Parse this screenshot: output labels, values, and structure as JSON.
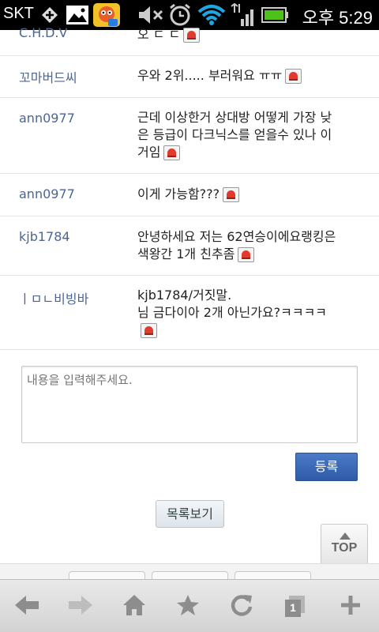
{
  "status_bar": {
    "carrier": "SKT",
    "time": "오후 5:29",
    "icons": [
      "signal-plus-icon",
      "gallery-icon",
      "game-app-icon",
      "mute-icon",
      "alarm-icon",
      "wifi-icon",
      "cell-signal-icon",
      "battery-icon"
    ]
  },
  "comments": [
    {
      "author": "C.H.D.V",
      "text": "오 ㄷ ㄷ"
    },
    {
      "author": "꼬마버드씨",
      "text": "우와 2위..... 부러워요 ㅠㅠ"
    },
    {
      "author": "ann0977",
      "text": "근데 이상한거 상대방 어떻게 가장 낮은 등급이 다크닉스를 얻을수 있나 이거임"
    },
    {
      "author": "ann0977",
      "text": "이게 가능함???"
    },
    {
      "author": "kjb1784",
      "text": "안녕하세요 저는 62연승이에요랭킹은색왕간 1개 친추좀"
    },
    {
      "author": "ㅣㅁㄴ비빙바",
      "text": "kjb1784/거짓말.\n님 금다이아 2개 아닌가요?ㅋㅋㅋㅋ"
    }
  ],
  "form": {
    "placeholder": "내용을 입력해주세요.",
    "submit_label": "등록",
    "list_label": "목록보기",
    "top_label": "TOP"
  },
  "browser_bar": {
    "buttons": [
      "back-icon",
      "forward-icon",
      "home-icon",
      "bookmark-star-icon",
      "refresh-icon",
      "tabs-icon",
      "new-tab-icon"
    ],
    "tab_count": "1"
  },
  "colors": {
    "author": "#4e6591",
    "submit_button": "#3a68b8",
    "report_icon": "#e23a2e"
  }
}
